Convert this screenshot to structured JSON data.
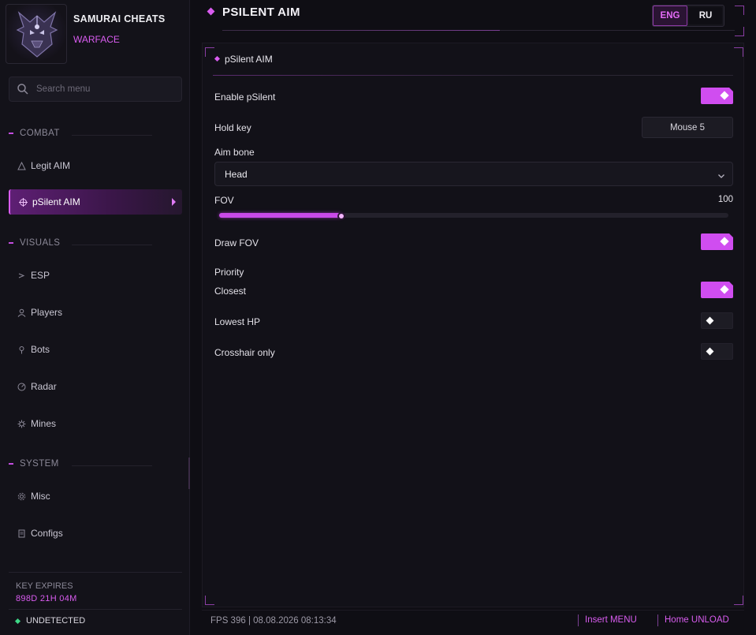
{
  "brand": {
    "title": "SAMURAI CHEATS",
    "subtitle": "WARFACE"
  },
  "search": {
    "placeholder": "Search menu"
  },
  "sidebar": {
    "sections": [
      {
        "label": "COMBAT"
      },
      {
        "label": "VISUALS"
      },
      {
        "label": "SYSTEM"
      }
    ],
    "items": [
      {
        "label": "Legit AIM",
        "icon": "triangle-icon"
      },
      {
        "label": "pSilent AIM",
        "icon": "crosshair-icon",
        "active": true
      },
      {
        "label": "ESP",
        "icon": "chevron-icon"
      },
      {
        "label": "Players",
        "icon": "user-icon"
      },
      {
        "label": "Bots",
        "icon": "pin-icon"
      },
      {
        "label": "Radar",
        "icon": "radar-icon"
      },
      {
        "label": "Mines",
        "icon": "mine-icon"
      },
      {
        "label": "Misc",
        "icon": "gear-icon"
      },
      {
        "label": "Configs",
        "icon": "file-icon"
      }
    ],
    "footer": {
      "key_label": "KEY EXPIRES",
      "key_value": "898D  21H  04M",
      "status": "UNDETECTED"
    }
  },
  "header": {
    "title": "PSILENT AIM",
    "languages": [
      {
        "label": "ENG",
        "selected": true
      },
      {
        "label": "RU",
        "selected": false
      }
    ]
  },
  "panel": {
    "title": "pSilent AIM",
    "enable_label": "Enable pSilent",
    "enable_on": true,
    "hold_key_label": "Hold key",
    "hold_key_value": "Mouse 5",
    "aim_bone_label": "Aim bone",
    "aim_bone_value": "Head",
    "fov_label": "FOV",
    "fov_value": "100",
    "fov_fraction": 0.24,
    "draw_fov_label": "Draw FOV",
    "draw_fov_on": true,
    "priority_label": "Priority",
    "priorities": [
      {
        "label": "Closest",
        "on": true
      },
      {
        "label": "Lowest HP",
        "on": false
      },
      {
        "label": "Crosshair only",
        "on": false
      }
    ]
  },
  "status_bar": {
    "fps_text": "FPS 396  |  08.08.2026 08:13:34",
    "insert_key": "Insert",
    "insert_action": "MENU",
    "home_key": "Home",
    "home_action": "UNLOAD"
  },
  "colors": {
    "accent": "#d95cf0",
    "background": "#0f0e14",
    "status_ok": "#3ed987"
  }
}
